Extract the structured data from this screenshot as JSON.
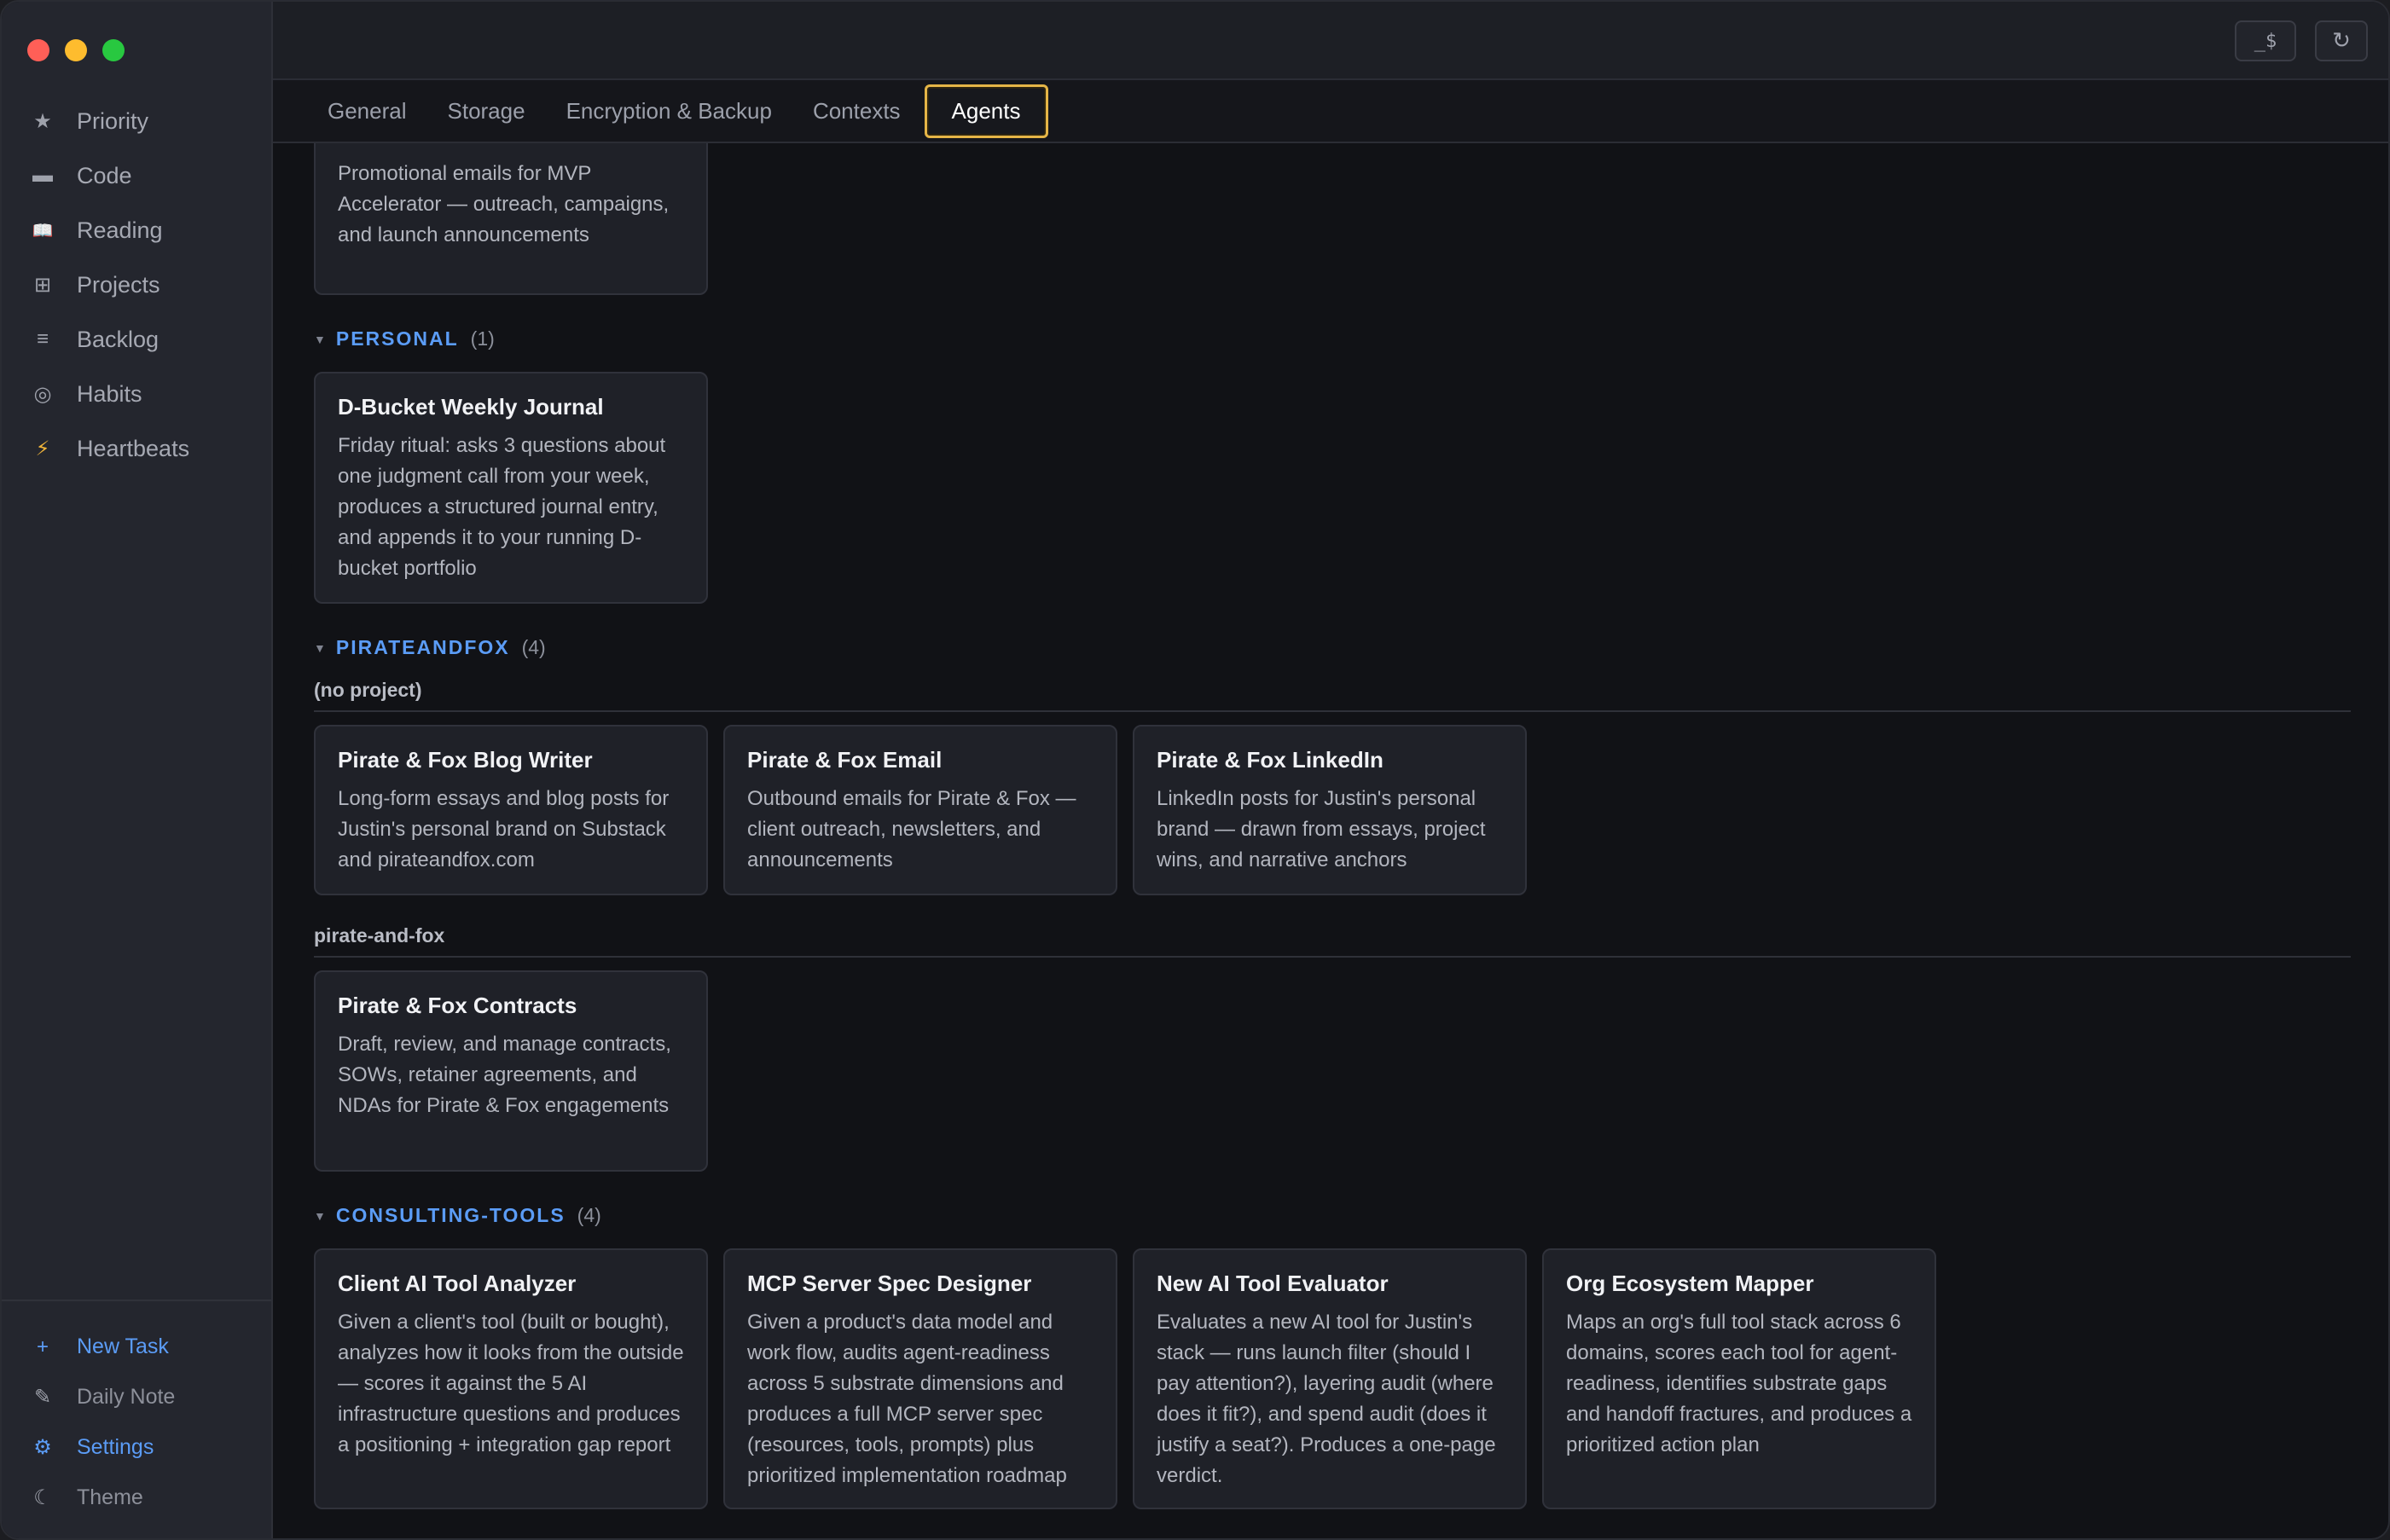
{
  "sidebar": {
    "nav": [
      {
        "label": "Priority",
        "icon": "★"
      },
      {
        "label": "Code",
        "icon": "▬"
      },
      {
        "label": "Reading",
        "icon": "📖"
      },
      {
        "label": "Projects",
        "icon": "⊞"
      },
      {
        "label": "Backlog",
        "icon": "≡"
      },
      {
        "label": "Habits",
        "icon": "◎"
      },
      {
        "label": "Heartbeats",
        "icon": "⚡"
      }
    ],
    "bottom": [
      {
        "label": "New Task",
        "icon": "+"
      },
      {
        "label": "Daily Note",
        "icon": "✎"
      },
      {
        "label": "Settings",
        "icon": "⚙"
      },
      {
        "label": "Theme",
        "icon": "☾"
      }
    ]
  },
  "topbar": {
    "terminal_label": "_$",
    "refresh_icon": "↻"
  },
  "tabs": [
    {
      "label": "General"
    },
    {
      "label": "Storage"
    },
    {
      "label": "Encryption & Backup"
    },
    {
      "label": "Contexts"
    },
    {
      "label": "Agents"
    }
  ],
  "top_card": {
    "desc": "Promotional emails for MVP Accelerator — outreach, campaigns, and launch announcements"
  },
  "sections": {
    "personal": {
      "name": "PERSONAL",
      "count": "(1)",
      "cards": [
        {
          "title": "D-Bucket Weekly Journal",
          "desc": "Friday ritual: asks 3 questions about one judgment call from your week, produces a structured journal entry, and appends it to your running D-bucket portfolio"
        }
      ]
    },
    "pirateandfox": {
      "name": "PIRATEANDFOX",
      "count": "(4)",
      "groups": [
        {
          "label": "(no project)",
          "cards": [
            {
              "title": "Pirate & Fox Blog Writer",
              "desc": "Long-form essays and blog posts for Justin's personal brand on Substack and pirateandfox.com"
            },
            {
              "title": "Pirate & Fox Email",
              "desc": "Outbound emails for Pirate & Fox — client outreach, newsletters, and announcements"
            },
            {
              "title": "Pirate & Fox LinkedIn",
              "desc": "LinkedIn posts for Justin's personal brand — drawn from essays, project wins, and narrative anchors"
            }
          ]
        },
        {
          "label": "pirate-and-fox",
          "cards": [
            {
              "title": "Pirate & Fox Contracts",
              "desc": "Draft, review, and manage contracts, SOWs, retainer agreements, and NDAs for Pirate & Fox engagements"
            }
          ]
        }
      ]
    },
    "consulting": {
      "name": "CONSULTING-TOOLS",
      "count": "(4)",
      "cards": [
        {
          "title": "Client AI Tool Analyzer",
          "desc": "Given a client's tool (built or bought), analyzes how it looks from the outside — scores it against the 5 AI infrastructure questions and produces a positioning + integration gap report"
        },
        {
          "title": "MCP Server Spec Designer",
          "desc": "Given a product's data model and work flow, audits agent-readiness across 5 substrate dimensions and produces a full MCP server spec (resources, tools, prompts) plus prioritized implementation roadmap"
        },
        {
          "title": "New AI Tool Evaluator",
          "desc": "Evaluates a new AI tool for Justin's stack — runs launch filter (should I pay attention?), layering audit (where does it fit?), and spend audit (does it justify a seat?). Produces a one-page verdict."
        },
        {
          "title": "Org Ecosystem Mapper",
          "desc": "Maps an org's full tool stack across 6 domains, scores each tool for agent-readiness, identifies substrate gaps and handoff fractures, and produces a prioritized action plan"
        }
      ]
    }
  }
}
